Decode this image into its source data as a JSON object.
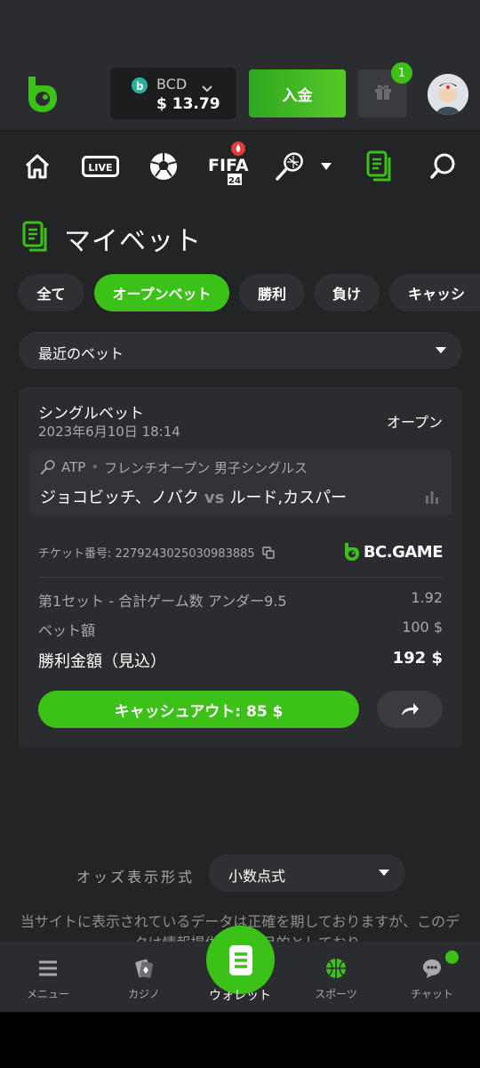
{
  "colors": {
    "accent": "#3bc117",
    "background": "#232426",
    "panel": "#2b2c2f"
  },
  "header": {
    "coin": "BCD",
    "balance": "$ 13.79",
    "deposit_label": "入金",
    "gift_count": "1"
  },
  "sport_nav": {
    "icons": [
      "home-icon",
      "live-icon",
      "soccer-icon",
      "fifa-icon",
      "tennis-icon",
      "bets-icon",
      "search-icon"
    ],
    "live_label": "LIVE",
    "fifa_label": "FIFA",
    "fifa_sub": "24"
  },
  "page": {
    "title": "マイベット"
  },
  "filters": [
    "全て",
    "オープンベット",
    "勝利",
    "負け",
    "キャッシ"
  ],
  "filter_active": "オープンベット",
  "sort_dropdown": {
    "value": "最近のベット"
  },
  "bet": {
    "type": "シングルベット",
    "date": "2023年6月10日 18:14",
    "status": "オープン",
    "sport": "ATP",
    "league": "フレンチオープン 男子シングルス",
    "home": "ジョコビッチ、ノバク",
    "vs": "vs",
    "away": "ルード,カスパー",
    "ticket": "チケット番号: 2279243025030983885",
    "brand": "BC.GAME",
    "market_label": "第1セット - 合計ゲーム数 アンダー9.5",
    "odds": "1.92",
    "stake_label": "ベット額",
    "stake": "100 $",
    "payout_label": "勝利金額（見込）",
    "payout": "192 $",
    "cashout_label": "キャッシュアウト: 85 $"
  },
  "odds_format": {
    "label": "オッズ表示形式",
    "value": "小数点式"
  },
  "disclaimer": "当サイトに表示されているデータは正確を期しておりますが、このデータは情報提供のみを目的としており",
  "bottom_nav": {
    "menu": "メニュー",
    "casino": "カジノ",
    "wallet": "ウォレット",
    "sports": "スポーツ",
    "chat": "チャット"
  }
}
